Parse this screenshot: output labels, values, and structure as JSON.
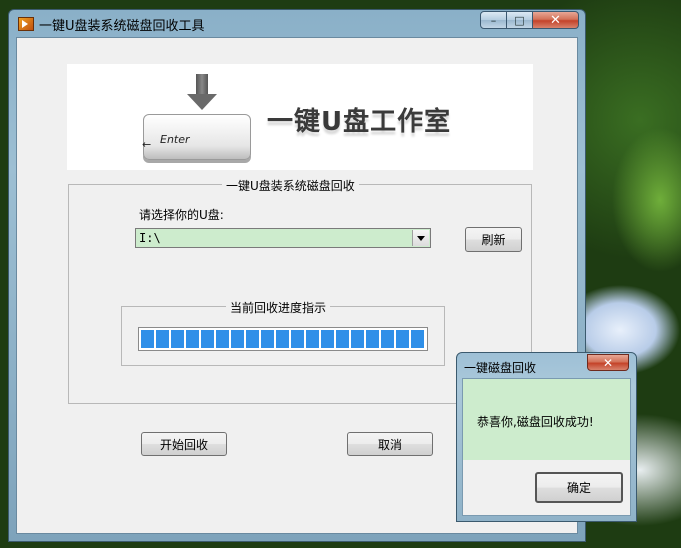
{
  "window": {
    "title": "一键U盘装系统磁盘回收工具",
    "controls": {
      "minimize": "–",
      "maximize": "□",
      "close": "✕"
    }
  },
  "banner": {
    "key_label": "Enter",
    "key_arrow": "←",
    "brand": "一键U盘工作室"
  },
  "main_group": {
    "legend": "一键U盘装系统磁盘回收",
    "prompt": "请选择你的U盘:",
    "drive_selected": "I:\\",
    "refresh_label": "刷新"
  },
  "progress": {
    "legend": "当前回收进度指示",
    "value": 1.0
  },
  "buttons": {
    "start": "开始回收",
    "cancel": "取消"
  },
  "dialog": {
    "title": "一键磁盘回收",
    "message": "恭喜你,磁盘回收成功!",
    "ok": "确定",
    "close": "✕"
  },
  "colors": {
    "progress_fill": "#2f8fe8",
    "input_bg": "#cdeccd"
  }
}
